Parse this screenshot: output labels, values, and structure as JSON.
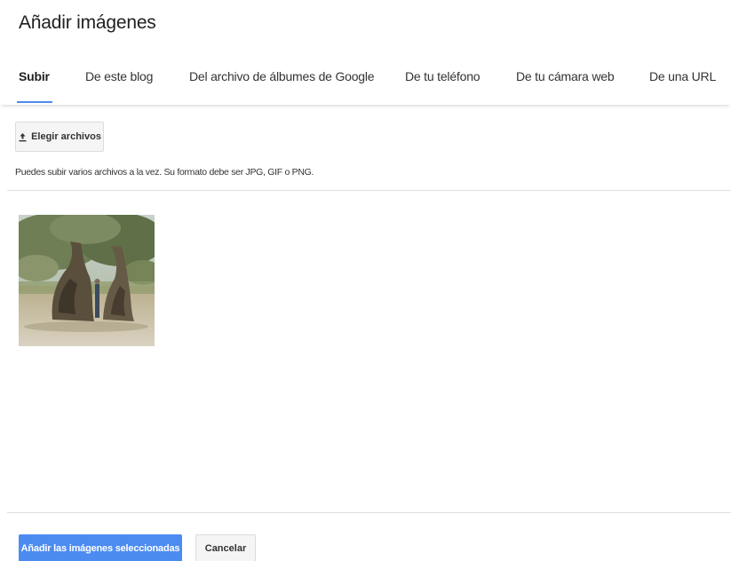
{
  "dialog": {
    "title": "Añadir imágenes"
  },
  "tabs": [
    {
      "label": "Subir",
      "active": true
    },
    {
      "label": "De este blog",
      "active": false
    },
    {
      "label": "Del archivo de álbumes de Google",
      "active": false
    },
    {
      "label": "De tu teléfono",
      "active": false
    },
    {
      "label": "De tu cámara web",
      "active": false
    },
    {
      "label": "De una URL",
      "active": false
    }
  ],
  "upload": {
    "button_label": "Elegir archivos",
    "icon": "upload-icon",
    "hint": "Puedes subir varios archivos a la vez. Su formato debe ser JPG, GIF o PNG."
  },
  "footer": {
    "primary_label": "Añadir las imágenes seleccionadas",
    "secondary_label": "Cancelar"
  },
  "colors": {
    "accent": "#4c8cf1",
    "divider": "#e0e0e0",
    "button_bg": "#f5f5f5"
  }
}
